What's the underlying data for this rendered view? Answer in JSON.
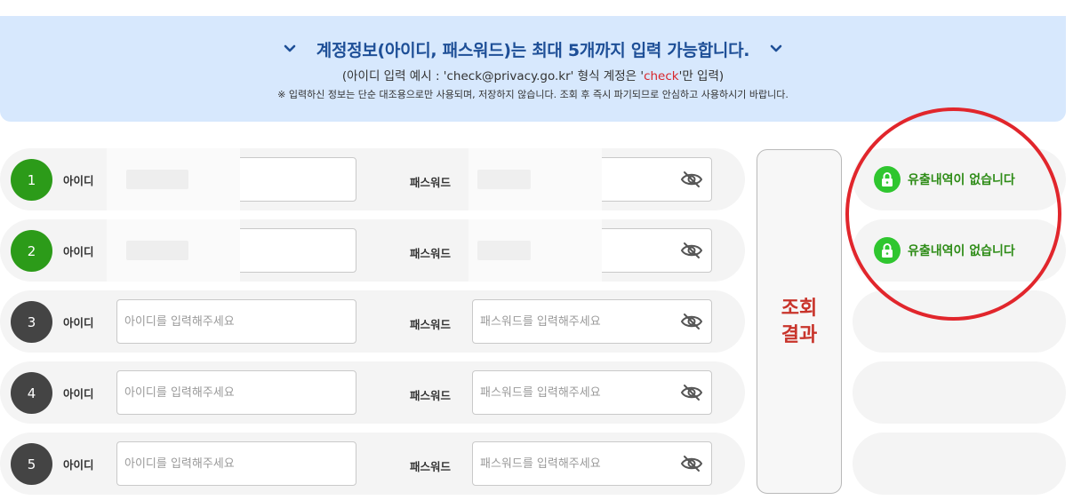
{
  "banner": {
    "title": "계정정보(아이디, 패스워드)는 최대 5개까지 입력 가능합니다.",
    "sub_prefix": "(아이디 입력 예시 : 'check@privacy.go.kr' 형식 계정은 '",
    "sub_highlight": "check",
    "sub_suffix": "'만 입력)",
    "note": "※ 입력하신 정보는 단순 대조용으로만 사용되며, 저장하지 않습니다. 조회 후 즉시 파기되므로 안심하고 사용하시기 바랍니다.",
    "icons": [
      "chevron-down-icon",
      "chevron-down-icon"
    ]
  },
  "form": {
    "id_label": "아이디",
    "pw_label": "패스워드",
    "id_placeholder": "아이디를 입력해주세요",
    "pw_placeholder": "패스워드를 입력해주세요",
    "rows": [
      {
        "number": "1",
        "status": "filled",
        "color": "#2c9b19"
      },
      {
        "number": "2",
        "status": "filled",
        "color": "#2c9b19"
      },
      {
        "number": "3",
        "status": "empty",
        "color": "#444444"
      },
      {
        "number": "4",
        "status": "empty",
        "color": "#444444"
      },
      {
        "number": "5",
        "status": "empty",
        "color": "#444444"
      }
    ]
  },
  "result_button": {
    "line1": "조회",
    "line2": "결과",
    "color": "#c8342b"
  },
  "results": [
    {
      "text": "유출내역이 없습니다",
      "icon": "lock-icon"
    },
    {
      "text": "유출내역이 없습니다",
      "icon": "lock-icon"
    }
  ],
  "highlight_color": "#e1262c"
}
